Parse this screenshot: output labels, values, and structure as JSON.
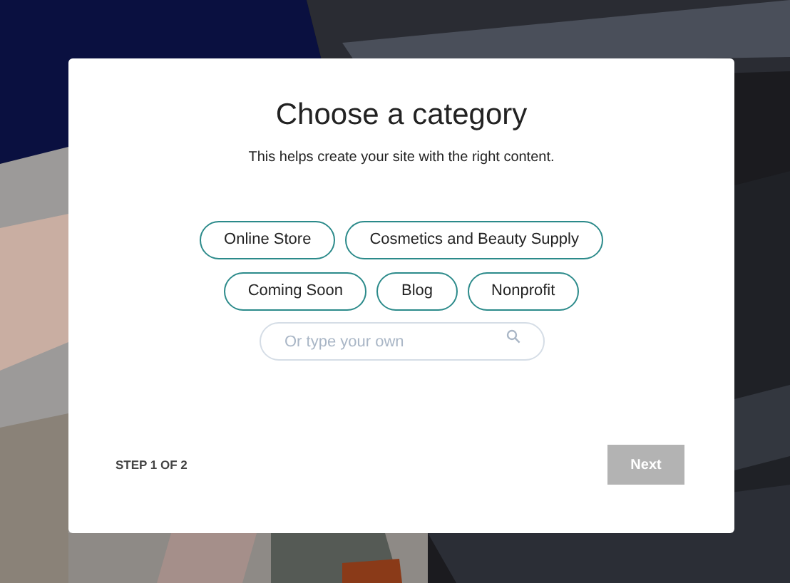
{
  "dialog": {
    "title": "Choose a category",
    "subtitle": "This helps create your site with the right content.",
    "categories": [
      {
        "label": "Online Store",
        "selected": false
      },
      {
        "label": "Cosmetics and Beauty Supply",
        "selected": false
      },
      {
        "label": "Coming Soon",
        "selected": false
      },
      {
        "label": "Blog",
        "selected": false
      },
      {
        "label": "Nonprofit",
        "selected": false
      }
    ],
    "search": {
      "placeholder": "Or type your own"
    },
    "step": "STEP 1 OF 2",
    "next_button": {
      "label": "Next",
      "disabled": true
    }
  }
}
